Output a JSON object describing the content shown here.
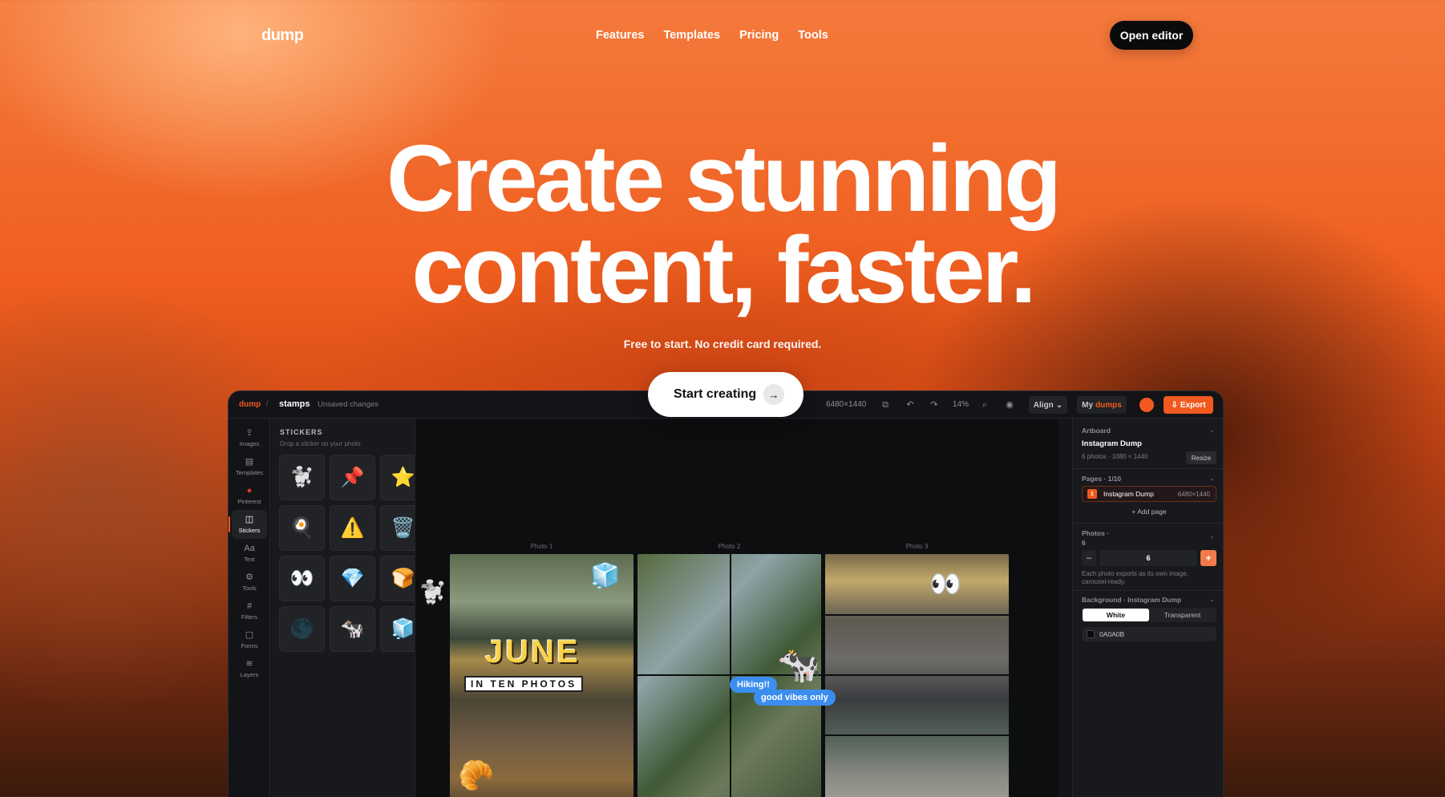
{
  "nav": {
    "logo": "dump",
    "links": [
      "Features",
      "Templates",
      "Pricing",
      "Tools"
    ],
    "cta": "Open editor"
  },
  "hero": {
    "title_line1": "Create stunning",
    "title_line2": "content, faster.",
    "subtitle": "Free to start. No credit card required.",
    "cta": "Start creating",
    "cta_icon": "arrow-right-icon"
  },
  "app": {
    "topbar": {
      "logo": "dump",
      "separator": "/",
      "project_name": "stamps",
      "status": "Unsaved changes",
      "dimensions": "6480×1440",
      "zoom": "14%",
      "align_label": "Align",
      "my_label": "My",
      "dumps_label": "dumps",
      "export_label": "Export"
    },
    "rail": [
      {
        "label": "Images",
        "icon": "upload-icon"
      },
      {
        "label": "Templates",
        "icon": "template-icon"
      },
      {
        "label": "Pinterest",
        "icon": "pinterest-icon"
      },
      {
        "label": "Stickers",
        "icon": "sticker-icon",
        "active": true
      },
      {
        "label": "Text",
        "icon": "text-icon"
      },
      {
        "label": "Tools",
        "icon": "tools-icon"
      },
      {
        "label": "Filters",
        "icon": "hash-icon"
      },
      {
        "label": "Forms",
        "icon": "square-icon"
      },
      {
        "label": "Layers",
        "icon": "layers-icon"
      }
    ],
    "stickers_panel": {
      "title": "STICKERS",
      "subtitle": "Drop a sticker on your photo.",
      "items": [
        "🐩",
        "📌",
        "⭐",
        "🍳",
        "⚠️",
        "🗑️",
        "👀",
        "💎",
        "🍞",
        "🌑",
        "🐄",
        "🧊"
      ]
    },
    "canvas": {
      "photo_labels": [
        "Photo 1",
        "Photo 2",
        "Photo 3"
      ],
      "june_text": "JUNE",
      "ten_photos_text": "IN TEN PHOTOS",
      "bubble1": "Hiking!!",
      "bubble2": "good vibes only"
    },
    "right_panel": {
      "artboard_header": "Artboard",
      "artboard_name": "Instagram Dump",
      "artboard_info": "6 photos · 1080 × 1440",
      "resize_label": "Resize",
      "pages_header": "Pages · 1/10",
      "page_number": "1",
      "page_name": "Instagram Dump",
      "page_dims": "6480×1440",
      "add_page": "+ Add page",
      "photos_header": "Photos ·",
      "photos_count_label": "6",
      "stepper_minus": "–",
      "stepper_value": "6",
      "stepper_plus": "+",
      "photos_note": "Each photo exports as its own image, carousel-ready.",
      "background_header": "Background · Instagram Dump",
      "bg_options": [
        "White",
        "Transparent"
      ],
      "bg_color": "0A0A0B"
    }
  },
  "colors": {
    "accent": "#f2591f",
    "app_bg": "#141518",
    "cta_bg": "#ffffff"
  }
}
